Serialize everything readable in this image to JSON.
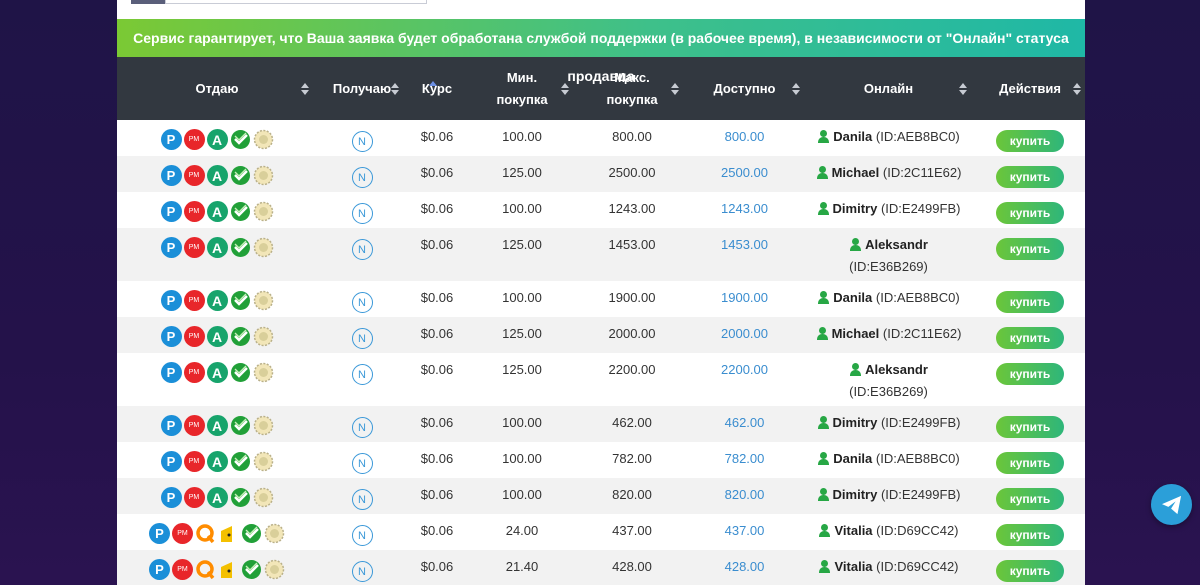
{
  "banner": "Сервис гарантирует, что Ваша заявка будет обработана службой поддержки (в рабочее время), в независимости от \"Онлайн\" статуса продавца",
  "columns": {
    "give": "Отдаю",
    "get": "Получаю",
    "rate": "Курс",
    "min_line1": "Мин.",
    "min_line2": "покупка",
    "max_line1": "Макс.",
    "max_line2": "покупка",
    "available": "Доступно",
    "online": "Онлайн",
    "actions": "Действия"
  },
  "get_icon_letter": "N",
  "buy_label": "купить",
  "icon_glyphs": {
    "payeer": "P",
    "perfect_money": "PM",
    "advcash": "A"
  },
  "rows": [
    {
      "icons": [
        "payeer-icon",
        "perfect-money-icon",
        "advcash-icon",
        "sberbank-icon",
        "tinkoff-icon"
      ],
      "rate": "$0.06",
      "min": "100.00",
      "max": "800.00",
      "available": "800.00",
      "name": "Danila",
      "id": "(ID:AEB8BC0)"
    },
    {
      "icons": [
        "payeer-icon",
        "perfect-money-icon",
        "advcash-icon",
        "sberbank-icon",
        "tinkoff-icon"
      ],
      "rate": "$0.06",
      "min": "125.00",
      "max": "2500.00",
      "available": "2500.00",
      "name": "Michael",
      "id": "(ID:2C11E62)"
    },
    {
      "icons": [
        "payeer-icon",
        "perfect-money-icon",
        "advcash-icon",
        "sberbank-icon",
        "tinkoff-icon"
      ],
      "rate": "$0.06",
      "min": "100.00",
      "max": "1243.00",
      "available": "1243.00",
      "name": "Dimitry",
      "id": "(ID:E2499FB)"
    },
    {
      "icons": [
        "payeer-icon",
        "perfect-money-icon",
        "advcash-icon",
        "sberbank-icon",
        "tinkoff-icon"
      ],
      "rate": "$0.06",
      "min": "125.00",
      "max": "1453.00",
      "available": "1453.00",
      "name": "Aleksandr",
      "id": "(ID:E36B269)",
      "wrap": true
    },
    {
      "icons": [
        "payeer-icon",
        "perfect-money-icon",
        "advcash-icon",
        "sberbank-icon",
        "tinkoff-icon"
      ],
      "rate": "$0.06",
      "min": "100.00",
      "max": "1900.00",
      "available": "1900.00",
      "name": "Danila",
      "id": "(ID:AEB8BC0)"
    },
    {
      "icons": [
        "payeer-icon",
        "perfect-money-icon",
        "advcash-icon",
        "sberbank-icon",
        "tinkoff-icon"
      ],
      "rate": "$0.06",
      "min": "125.00",
      "max": "2000.00",
      "available": "2000.00",
      "name": "Michael",
      "id": "(ID:2C11E62)"
    },
    {
      "icons": [
        "payeer-icon",
        "perfect-money-icon",
        "advcash-icon",
        "sberbank-icon",
        "tinkoff-icon"
      ],
      "rate": "$0.06",
      "min": "125.00",
      "max": "2200.00",
      "available": "2200.00",
      "name": "Aleksandr",
      "id": "(ID:E36B269)",
      "wrap": true
    },
    {
      "icons": [
        "payeer-icon",
        "perfect-money-icon",
        "advcash-icon",
        "sberbank-icon",
        "tinkoff-icon"
      ],
      "rate": "$0.06",
      "min": "100.00",
      "max": "462.00",
      "available": "462.00",
      "name": "Dimitry",
      "id": "(ID:E2499FB)"
    },
    {
      "icons": [
        "payeer-icon",
        "perfect-money-icon",
        "advcash-icon",
        "sberbank-icon",
        "tinkoff-icon"
      ],
      "rate": "$0.06",
      "min": "100.00",
      "max": "782.00",
      "available": "782.00",
      "name": "Danila",
      "id": "(ID:AEB8BC0)"
    },
    {
      "icons": [
        "payeer-icon",
        "perfect-money-icon",
        "advcash-icon",
        "sberbank-icon",
        "tinkoff-icon"
      ],
      "rate": "$0.06",
      "min": "100.00",
      "max": "820.00",
      "available": "820.00",
      "name": "Dimitry",
      "id": "(ID:E2499FB)"
    },
    {
      "icons": [
        "payeer-icon",
        "perfect-money-icon",
        "qiwi-icon",
        "yandex-money-icon",
        "sberbank-icon",
        "tinkoff-icon"
      ],
      "rate": "$0.06",
      "min": "24.00",
      "max": "437.00",
      "available": "437.00",
      "name": "Vitalia",
      "id": "(ID:D69CC42)"
    },
    {
      "icons": [
        "payeer-icon",
        "perfect-money-icon",
        "qiwi-icon",
        "yandex-money-icon",
        "sberbank-icon",
        "tinkoff-icon"
      ],
      "rate": "$0.06",
      "min": "21.40",
      "max": "428.00",
      "available": "428.00",
      "name": "Vitalia",
      "id": "(ID:D69CC42)"
    }
  ]
}
